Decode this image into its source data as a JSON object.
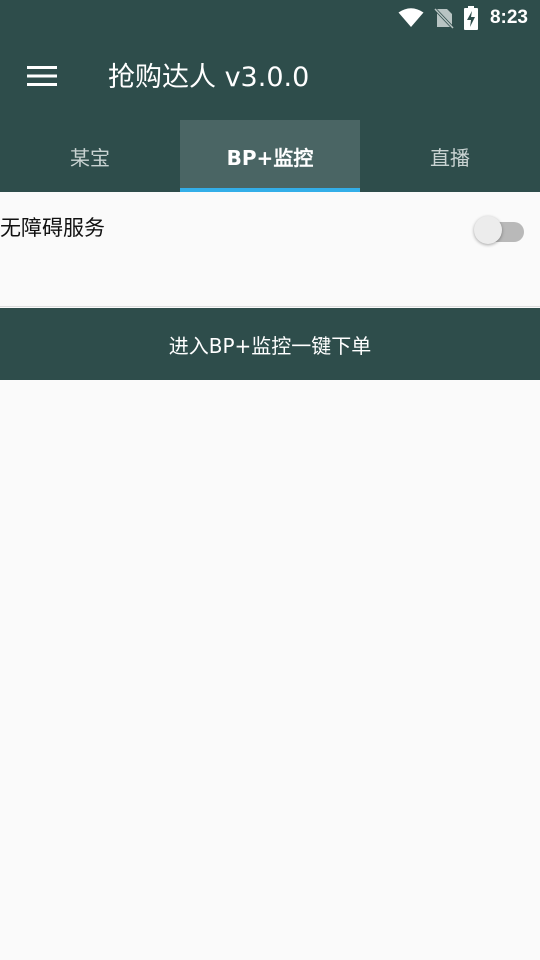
{
  "status_bar": {
    "time": "8:23",
    "icons": [
      "wifi-icon",
      "no-sim-icon",
      "battery-charging-icon"
    ],
    "color": "#2e4d4b"
  },
  "app_bar": {
    "title": "抢购达人 v3.0.0",
    "menu_icon": "menu-icon",
    "background": "#2e4d4b"
  },
  "tabs": [
    {
      "label": "某宝",
      "active": false
    },
    {
      "label": "BP+监控",
      "active": true
    },
    {
      "label": "直播",
      "active": false
    }
  ],
  "tab_indicator_color": "#33aee8",
  "settings": {
    "accessibility_label": "无障碍服务",
    "accessibility_enabled": false
  },
  "action_button": {
    "label": "进入BP+监控一键下单"
  }
}
